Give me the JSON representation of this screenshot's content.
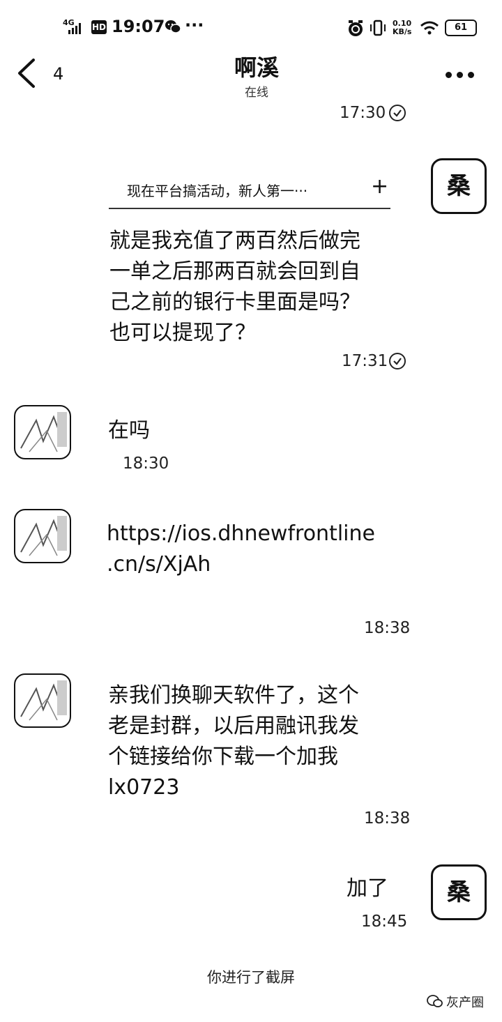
{
  "status_bar": {
    "network": "4G",
    "hd": "HD",
    "time": "19:07",
    "more": "···",
    "speed_value": "0.10",
    "speed_unit": "KB/s",
    "battery": "61"
  },
  "header": {
    "back_count": "4",
    "title": "啊溪",
    "status": "在线"
  },
  "self_avatar_text": "桑",
  "messages": [
    {
      "time": "17:30"
    },
    {
      "card_text": "现在平台搞活动，新人第一···",
      "card_action": "+",
      "lines": [
        "就是我充值了两百然后做完",
        "一单之后那两百就会回到自",
        "己之前的银行卡里面是吗？",
        "也可以提现了？"
      ],
      "time": "17:31"
    },
    {
      "lines": [
        "在吗"
      ],
      "time": "18:30"
    },
    {
      "lines": [
        "https://ios.dhnewfrontline",
        ".cn/s/XjAh"
      ],
      "time": "18:38"
    },
    {
      "lines": [
        "亲我们换聊天软件了，这个",
        "老是封群，以后用融讯我发",
        "个链接给你下载一个加我",
        "lx0723"
      ],
      "time": "18:38"
    },
    {
      "lines": [
        "加了"
      ],
      "time": "18:45"
    }
  ],
  "system_note": "你进行了截屏",
  "watermark": "灰产圈"
}
